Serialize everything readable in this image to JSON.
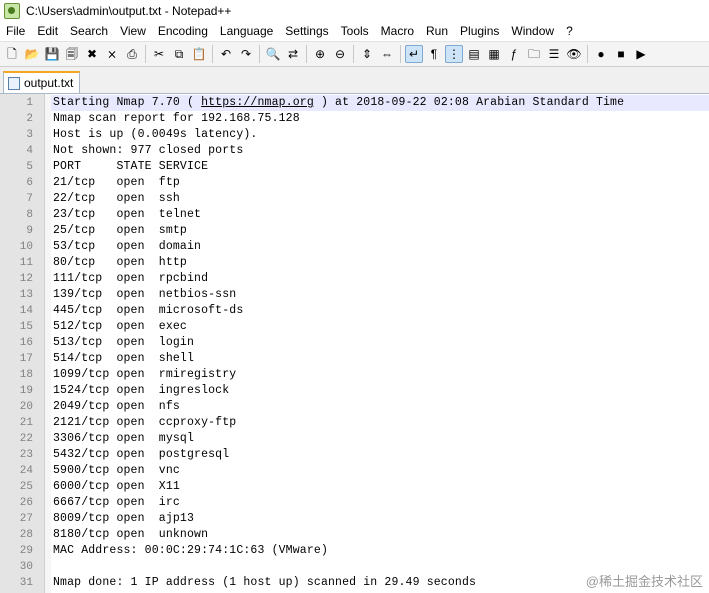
{
  "window": {
    "title": "C:\\Users\\admin\\output.txt - Notepad++"
  },
  "menu": [
    "File",
    "Edit",
    "Search",
    "View",
    "Encoding",
    "Language",
    "Settings",
    "Tools",
    "Macro",
    "Run",
    "Plugins",
    "Window",
    "?"
  ],
  "toolbar": [
    {
      "name": "new-file-icon",
      "glyph": "🗋"
    },
    {
      "name": "open-file-icon",
      "glyph": "📂"
    },
    {
      "name": "save-icon",
      "glyph": "💾"
    },
    {
      "name": "save-all-icon",
      "glyph": "🗐"
    },
    {
      "name": "close-icon",
      "glyph": "✖"
    },
    {
      "name": "close-all-icon",
      "glyph": "⨯"
    },
    {
      "name": "print-icon",
      "glyph": "⎙"
    },
    {
      "sep": true
    },
    {
      "name": "cut-icon",
      "glyph": "✂"
    },
    {
      "name": "copy-icon",
      "glyph": "⧉"
    },
    {
      "name": "paste-icon",
      "glyph": "📋"
    },
    {
      "sep": true
    },
    {
      "name": "undo-icon",
      "glyph": "↶"
    },
    {
      "name": "redo-icon",
      "glyph": "↷"
    },
    {
      "sep": true
    },
    {
      "name": "find-icon",
      "glyph": "🔍"
    },
    {
      "name": "replace-icon",
      "glyph": "⇄"
    },
    {
      "sep": true
    },
    {
      "name": "zoom-in-icon",
      "glyph": "⊕"
    },
    {
      "name": "zoom-out-icon",
      "glyph": "⊖"
    },
    {
      "sep": true
    },
    {
      "name": "sync-vertical-icon",
      "glyph": "⇕"
    },
    {
      "name": "sync-horizontal-icon",
      "glyph": "⇔"
    },
    {
      "sep": true
    },
    {
      "name": "word-wrap-icon",
      "glyph": "↵",
      "pressed": true
    },
    {
      "name": "show-all-chars-icon",
      "glyph": "¶"
    },
    {
      "name": "indent-guide-icon",
      "glyph": "⋮",
      "pressed": true
    },
    {
      "name": "user-lang-icon",
      "glyph": "▤"
    },
    {
      "name": "doc-map-icon",
      "glyph": "▦"
    },
    {
      "name": "function-list-icon",
      "glyph": "ƒ"
    },
    {
      "name": "folder-workspace-icon",
      "glyph": "🗀"
    },
    {
      "name": "doc-list-icon",
      "glyph": "☰"
    },
    {
      "name": "monitoring-icon",
      "glyph": "👁"
    },
    {
      "sep": true
    },
    {
      "name": "record-macro-icon",
      "glyph": "●"
    },
    {
      "name": "stop-macro-icon",
      "glyph": "■"
    },
    {
      "name": "play-macro-icon",
      "glyph": "▶"
    }
  ],
  "tab": {
    "label": "output.txt"
  },
  "editor": {
    "current_line": 1,
    "lines": [
      {
        "n": "1",
        "pre": "Starting Nmap 7.70 ( ",
        "url": "https://nmap.org",
        "post": " ) at 2018-09-22 02:08 Arabian Standard Time"
      },
      {
        "n": "2",
        "text": "Nmap scan report for 192.168.75.128"
      },
      {
        "n": "3",
        "text": "Host is up (0.0049s latency)."
      },
      {
        "n": "4",
        "text": "Not shown: 977 closed ports"
      },
      {
        "n": "5",
        "text": "PORT     STATE SERVICE"
      },
      {
        "n": "6",
        "text": "21/tcp   open  ftp"
      },
      {
        "n": "7",
        "text": "22/tcp   open  ssh"
      },
      {
        "n": "8",
        "text": "23/tcp   open  telnet"
      },
      {
        "n": "9",
        "text": "25/tcp   open  smtp"
      },
      {
        "n": "10",
        "text": "53/tcp   open  domain"
      },
      {
        "n": "11",
        "text": "80/tcp   open  http"
      },
      {
        "n": "12",
        "text": "111/tcp  open  rpcbind"
      },
      {
        "n": "13",
        "text": "139/tcp  open  netbios-ssn"
      },
      {
        "n": "14",
        "text": "445/tcp  open  microsoft-ds"
      },
      {
        "n": "15",
        "text": "512/tcp  open  exec"
      },
      {
        "n": "16",
        "text": "513/tcp  open  login"
      },
      {
        "n": "17",
        "text": "514/tcp  open  shell"
      },
      {
        "n": "18",
        "text": "1099/tcp open  rmiregistry"
      },
      {
        "n": "19",
        "text": "1524/tcp open  ingreslock"
      },
      {
        "n": "20",
        "text": "2049/tcp open  nfs"
      },
      {
        "n": "21",
        "text": "2121/tcp open  ccproxy-ftp"
      },
      {
        "n": "22",
        "text": "3306/tcp open  mysql"
      },
      {
        "n": "23",
        "text": "5432/tcp open  postgresql"
      },
      {
        "n": "24",
        "text": "5900/tcp open  vnc"
      },
      {
        "n": "25",
        "text": "6000/tcp open  X11"
      },
      {
        "n": "26",
        "text": "6667/tcp open  irc"
      },
      {
        "n": "27",
        "text": "8009/tcp open  ajp13"
      },
      {
        "n": "28",
        "text": "8180/tcp open  unknown"
      },
      {
        "n": "29",
        "text": "MAC Address: 00:0C:29:74:1C:63 (VMware)"
      },
      {
        "n": "30",
        "text": ""
      },
      {
        "n": "31",
        "text": "Nmap done: 1 IP address (1 host up) scanned in 29.49 seconds"
      }
    ]
  },
  "watermark": "@稀土掘金技术社区"
}
